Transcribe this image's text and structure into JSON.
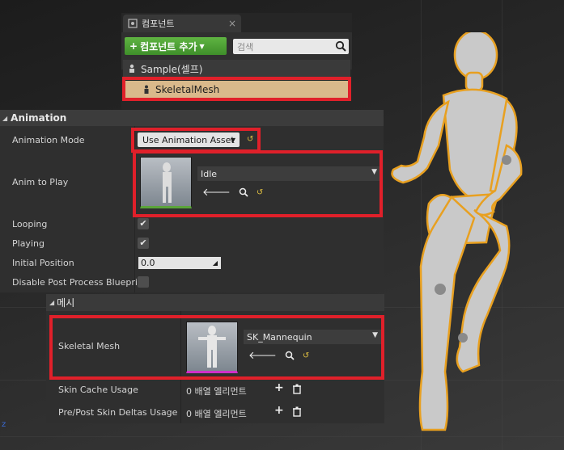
{
  "components_panel": {
    "tab_label": "컴포넌트",
    "close_glyph": "×",
    "add_button_label": "컴포넌트 추가",
    "search_placeholder": "검색",
    "self_row_label": "Sample(셀프)",
    "selected_row_label": "SkeletalMesh"
  },
  "animation_section": {
    "header": "Animation",
    "animation_mode_label": "Animation Mode",
    "animation_mode_value": "Use Animation Asset",
    "anim_to_play_label": "Anim to Play",
    "anim_to_play_value": "Idle",
    "looping_label": "Looping",
    "looping_checked": true,
    "playing_label": "Playing",
    "playing_checked": true,
    "initial_position_label": "Initial Position",
    "initial_position_value": "0.0",
    "disable_pp_label": "Disable Post Process Blueprin",
    "disable_pp_checked": false
  },
  "mesh_section": {
    "header": "메시",
    "skeletal_mesh_label": "Skeletal Mesh",
    "skeletal_mesh_value": "SK_Mannequin",
    "skin_cache_label": "Skin Cache Usage",
    "skin_cache_value": "0 배열 엘리먼트",
    "skin_deltas_label": "Pre/Post Skin Deltas Usage",
    "skin_deltas_value": "0 배열 엘리먼트"
  },
  "viewport": {
    "axis_label": "z"
  },
  "colors": {
    "highlight": "#e0202a",
    "selected_row": "#d9b98b",
    "add_button": "#4fa236",
    "mannequin_outline": "#e8a020"
  }
}
